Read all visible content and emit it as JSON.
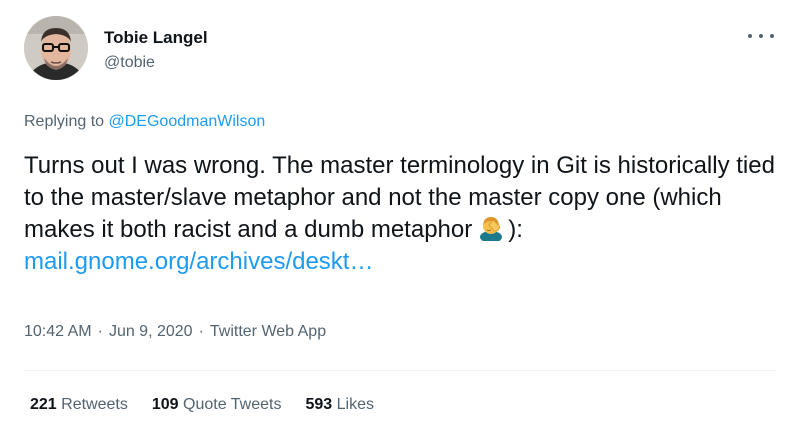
{
  "author": {
    "display_name": "Tobie Langel",
    "handle": "@tobie",
    "avatar_icon": "profile-photo"
  },
  "reply": {
    "prefix": "Replying to ",
    "mention": "@DEGoodmanWilson"
  },
  "tweet": {
    "text": "Turns out I was wrong. The master terminology in Git is historically tied to the master/slave metaphor and not the master copy one (which makes it both racist and a dumb metaphor",
    "emoji": "man-facepalming",
    "after_emoji": "):",
    "link": "mail.gnome.org/archives/deskt…"
  },
  "meta": {
    "time": "10:42 AM",
    "separator": "·",
    "date": "Jun 9, 2020",
    "source": "Twitter Web App"
  },
  "stats": {
    "retweets_count": "221",
    "retweets_label": "Retweets",
    "quotes_count": "109",
    "quotes_label": "Quote Tweets",
    "likes_count": "593",
    "likes_label": "Likes"
  },
  "colors": {
    "link": "#1d9bf0",
    "secondary_text": "#536471",
    "primary_text": "#0f1419"
  }
}
